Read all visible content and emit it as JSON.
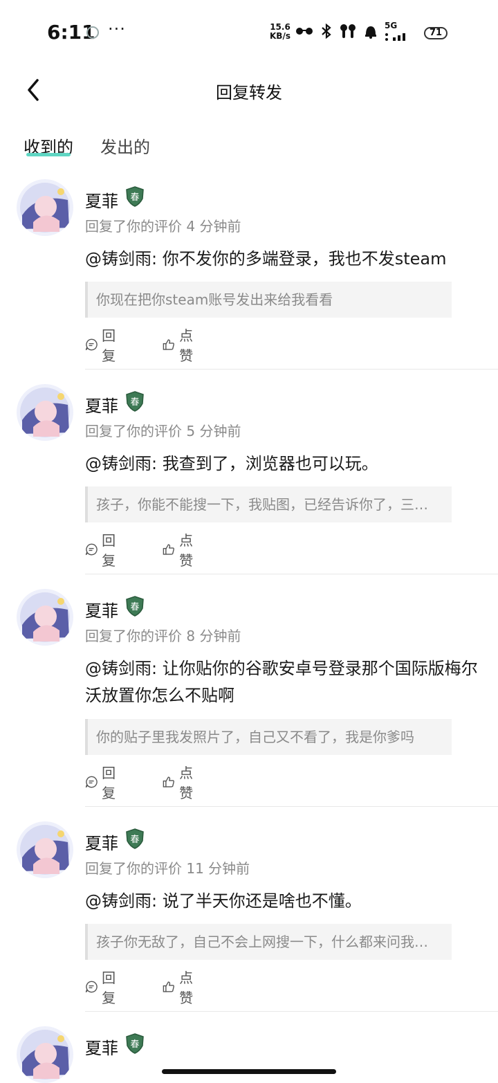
{
  "status_bar": {
    "time": "6:11",
    "dots": "···",
    "net_speed_value": "15.6",
    "net_speed_unit": "KB/s",
    "signal": "5G",
    "battery": "71"
  },
  "header": {
    "title": "回复转发"
  },
  "tabs": [
    {
      "label": "收到的",
      "active": true
    },
    {
      "label": "发出的",
      "active": false
    }
  ],
  "accent_color": "#5fd6c3",
  "items": [
    {
      "user": "夏菲",
      "badge": "春",
      "meta": "回复了你的评价 4 分钟前",
      "text": "@铸剑雨: 你不发你的多端登录，我也不发steam",
      "quote": "你现在把你steam账号发出来给我看看",
      "reply_label": "回复",
      "like_label": "点赞"
    },
    {
      "user": "夏菲",
      "badge": "春",
      "meta": "回复了你的评价 5 分钟前",
      "text": "@铸剑雨: 我查到了，浏览器也可以玩。",
      "quote": "孩子，你能不能搜一下，我贴图，已经告诉你了，三…",
      "reply_label": "回复",
      "like_label": "点赞"
    },
    {
      "user": "夏菲",
      "badge": "春",
      "meta": "回复了你的评价 8 分钟前",
      "text": "@铸剑雨: 让你贴你的谷歌安卓号登录那个国际版梅尔沃放置你怎么不贴啊",
      "quote": "你的贴子里我发照片了，自己又不看了，我是你爹吗",
      "reply_label": "回复",
      "like_label": "点赞"
    },
    {
      "user": "夏菲",
      "badge": "春",
      "meta": "回复了你的评价 11 分钟前",
      "text": "@铸剑雨: 说了半天你还是啥也不懂。",
      "quote": "孩子你无敌了，自己不会上网搜一下，什么都来问我…",
      "reply_label": "回复",
      "like_label": "点赞"
    },
    {
      "user": "夏菲",
      "badge": "春"
    }
  ]
}
